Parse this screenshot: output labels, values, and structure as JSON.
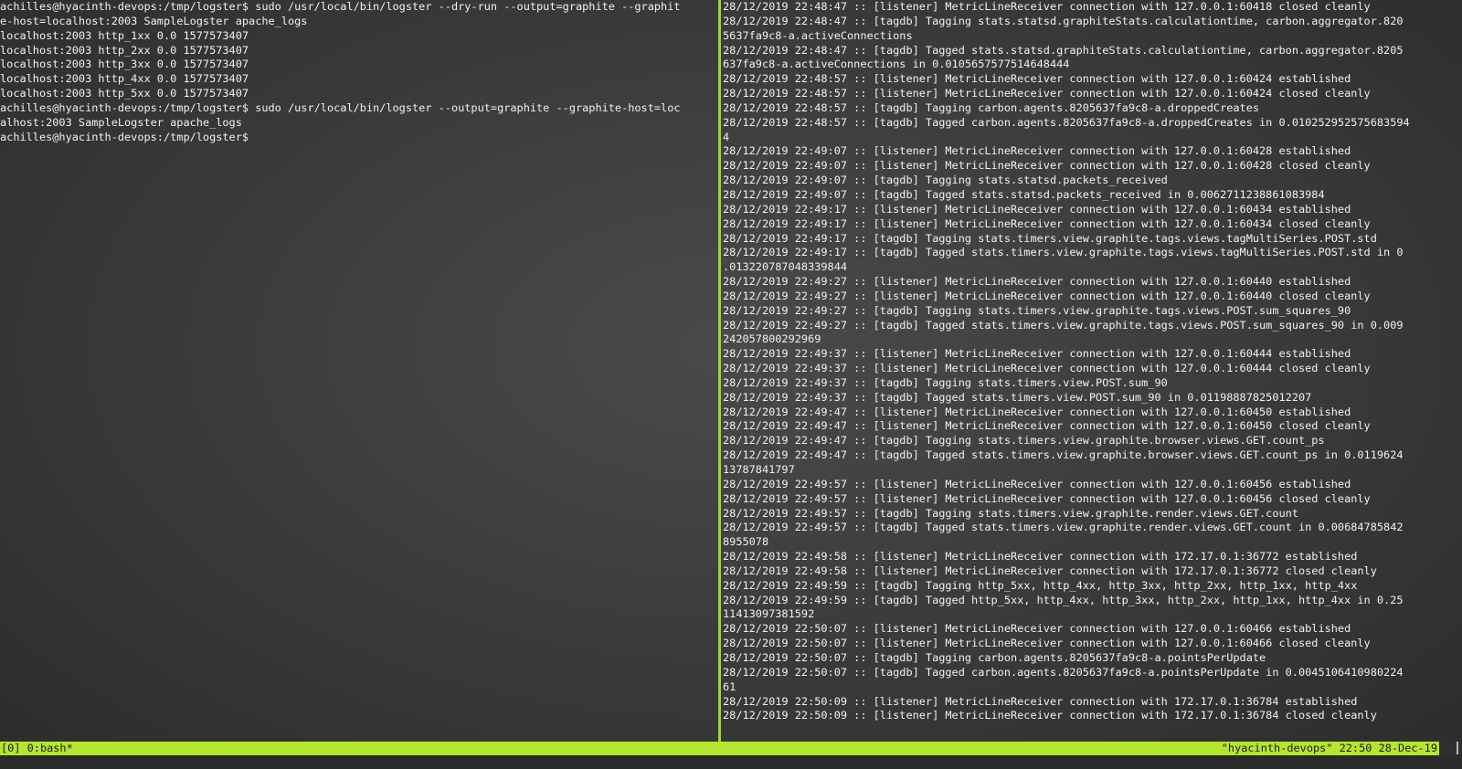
{
  "left_pane": {
    "lines": [
      "achilles@hyacinth-devops:/tmp/logster$ sudo /usr/local/bin/logster --dry-run --output=graphite --graphit",
      "e-host=localhost:2003 SampleLogster apache_logs",
      "localhost:2003 http_1xx 0.0 1577573407",
      "localhost:2003 http_2xx 0.0 1577573407",
      "localhost:2003 http_3xx 0.0 1577573407",
      "localhost:2003 http_4xx 0.0 1577573407",
      "localhost:2003 http_5xx 0.0 1577573407",
      "achilles@hyacinth-devops:/tmp/logster$ sudo /usr/local/bin/logster --output=graphite --graphite-host=loc",
      "alhost:2003 SampleLogster apache_logs",
      "achilles@hyacinth-devops:/tmp/logster$"
    ]
  },
  "right_pane": {
    "lines": [
      "28/12/2019 22:48:47 :: [listener] MetricLineReceiver connection with 127.0.0.1:60418 closed cleanly",
      "28/12/2019 22:48:47 :: [tagdb] Tagging stats.statsd.graphiteStats.calculationtime, carbon.aggregator.820",
      "5637fa9c8-a.activeConnections",
      "28/12/2019 22:48:47 :: [tagdb] Tagged stats.statsd.graphiteStats.calculationtime, carbon.aggregator.8205",
      "637fa9c8-a.activeConnections in 0.0105657577514648444",
      "28/12/2019 22:48:57 :: [listener] MetricLineReceiver connection with 127.0.0.1:60424 established",
      "28/12/2019 22:48:57 :: [listener] MetricLineReceiver connection with 127.0.0.1:60424 closed cleanly",
      "28/12/2019 22:48:57 :: [tagdb] Tagging carbon.agents.8205637fa9c8-a.droppedCreates",
      "28/12/2019 22:48:57 :: [tagdb] Tagged carbon.agents.8205637fa9c8-a.droppedCreates in 0.010252952575683594",
      "4",
      "28/12/2019 22:49:07 :: [listener] MetricLineReceiver connection with 127.0.0.1:60428 established",
      "28/12/2019 22:49:07 :: [listener] MetricLineReceiver connection with 127.0.0.1:60428 closed cleanly",
      "28/12/2019 22:49:07 :: [tagdb] Tagging stats.statsd.packets_received",
      "28/12/2019 22:49:07 :: [tagdb] Tagged stats.statsd.packets_received in 0.0062711238861083984",
      "28/12/2019 22:49:17 :: [listener] MetricLineReceiver connection with 127.0.0.1:60434 established",
      "28/12/2019 22:49:17 :: [listener] MetricLineReceiver connection with 127.0.0.1:60434 closed cleanly",
      "28/12/2019 22:49:17 :: [tagdb] Tagging stats.timers.view.graphite.tags.views.tagMultiSeries.POST.std",
      "28/12/2019 22:49:17 :: [tagdb] Tagged stats.timers.view.graphite.tags.views.tagMultiSeries.POST.std in 0",
      ".013220787048339844",
      "28/12/2019 22:49:27 :: [listener] MetricLineReceiver connection with 127.0.0.1:60440 established",
      "28/12/2019 22:49:27 :: [listener] MetricLineReceiver connection with 127.0.0.1:60440 closed cleanly",
      "28/12/2019 22:49:27 :: [tagdb] Tagging stats.timers.view.graphite.tags.views.POST.sum_squares_90",
      "28/12/2019 22:49:27 :: [tagdb] Tagged stats.timers.view.graphite.tags.views.POST.sum_squares_90 in 0.009",
      "242057800292969",
      "28/12/2019 22:49:37 :: [listener] MetricLineReceiver connection with 127.0.0.1:60444 established",
      "28/12/2019 22:49:37 :: [listener] MetricLineReceiver connection with 127.0.0.1:60444 closed cleanly",
      "28/12/2019 22:49:37 :: [tagdb] Tagging stats.timers.view.POST.sum_90",
      "28/12/2019 22:49:37 :: [tagdb] Tagged stats.timers.view.POST.sum_90 in 0.01198887825012207",
      "28/12/2019 22:49:47 :: [listener] MetricLineReceiver connection with 127.0.0.1:60450 established",
      "28/12/2019 22:49:47 :: [listener] MetricLineReceiver connection with 127.0.0.1:60450 closed cleanly",
      "28/12/2019 22:49:47 :: [tagdb] Tagging stats.timers.view.graphite.browser.views.GET.count_ps",
      "28/12/2019 22:49:47 :: [tagdb] Tagged stats.timers.view.graphite.browser.views.GET.count_ps in 0.0119624",
      "13787841797",
      "28/12/2019 22:49:57 :: [listener] MetricLineReceiver connection with 127.0.0.1:60456 established",
      "28/12/2019 22:49:57 :: [listener] MetricLineReceiver connection with 127.0.0.1:60456 closed cleanly",
      "28/12/2019 22:49:57 :: [tagdb] Tagging stats.timers.view.graphite.render.views.GET.count",
      "28/12/2019 22:49:57 :: [tagdb] Tagged stats.timers.view.graphite.render.views.GET.count in 0.00684785842",
      "8955078",
      "28/12/2019 22:49:58 :: [listener] MetricLineReceiver connection with 172.17.0.1:36772 established",
      "28/12/2019 22:49:58 :: [listener] MetricLineReceiver connection with 172.17.0.1:36772 closed cleanly",
      "28/12/2019 22:49:59 :: [tagdb] Tagging http_5xx, http_4xx, http_3xx, http_2xx, http_1xx, http_4xx",
      "28/12/2019 22:49:59 :: [tagdb] Tagged http_5xx, http_4xx, http_3xx, http_2xx, http_1xx, http_4xx in 0.25",
      "11413097381592",
      "28/12/2019 22:50:07 :: [listener] MetricLineReceiver connection with 127.0.0.1:60466 established",
      "28/12/2019 22:50:07 :: [listener] MetricLineReceiver connection with 127.0.0.1:60466 closed cleanly",
      "28/12/2019 22:50:07 :: [tagdb] Tagging carbon.agents.8205637fa9c8-a.pointsPerUpdate",
      "28/12/2019 22:50:07 :: [tagdb] Tagged carbon.agents.8205637fa9c8-a.pointsPerUpdate in 0.0045106410980224",
      "61",
      "28/12/2019 22:50:09 :: [listener] MetricLineReceiver connection with 172.17.0.1:36784 established",
      "28/12/2019 22:50:09 :: [listener] MetricLineReceiver connection with 172.17.0.1:36784 closed cleanly"
    ]
  },
  "status_bar": {
    "session_window": "[0] 0:bash*",
    "host_time_date": "\"hyacinth-devops\" 22:50 28-Dec-19"
  },
  "colors": {
    "background": "#404040",
    "text": "#f2f2f2",
    "status_bar": "#b5e62f",
    "active_divider": "#9fd42e"
  }
}
